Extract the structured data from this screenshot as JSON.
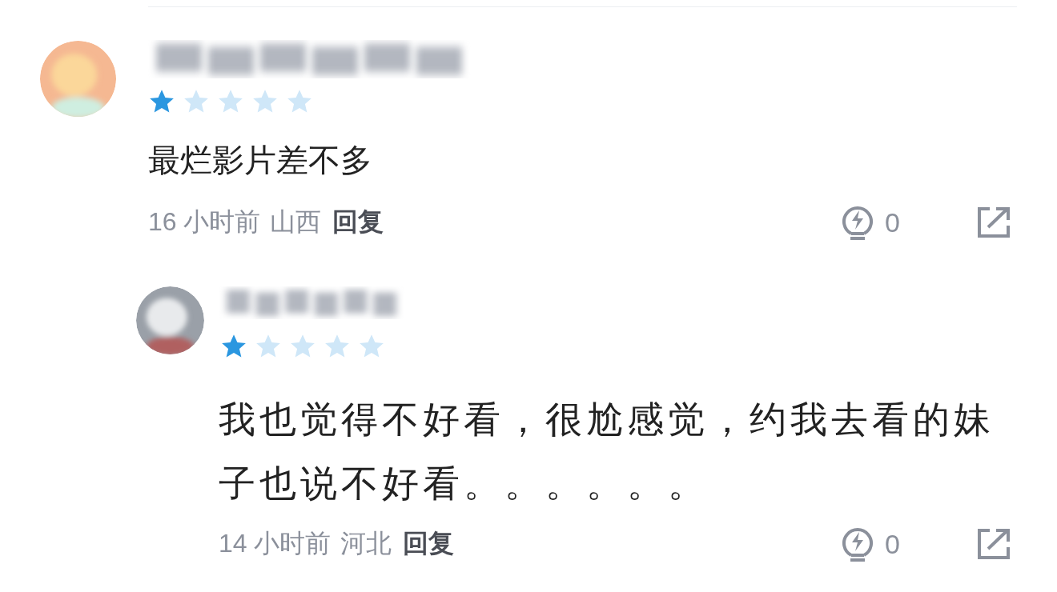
{
  "comments": [
    {
      "stars": 1,
      "text": "最烂影片差不多",
      "time": "16 小时前",
      "location": "山西",
      "reply": "回复",
      "likes": "0",
      "replies": [
        {
          "stars": 1,
          "text": "我也觉得不好看，很尬感觉，约我去看的妹子也说不好看。。。。。。",
          "time": "14 小时前",
          "location": "河北",
          "reply": "回复",
          "likes": "0"
        }
      ]
    }
  ]
}
